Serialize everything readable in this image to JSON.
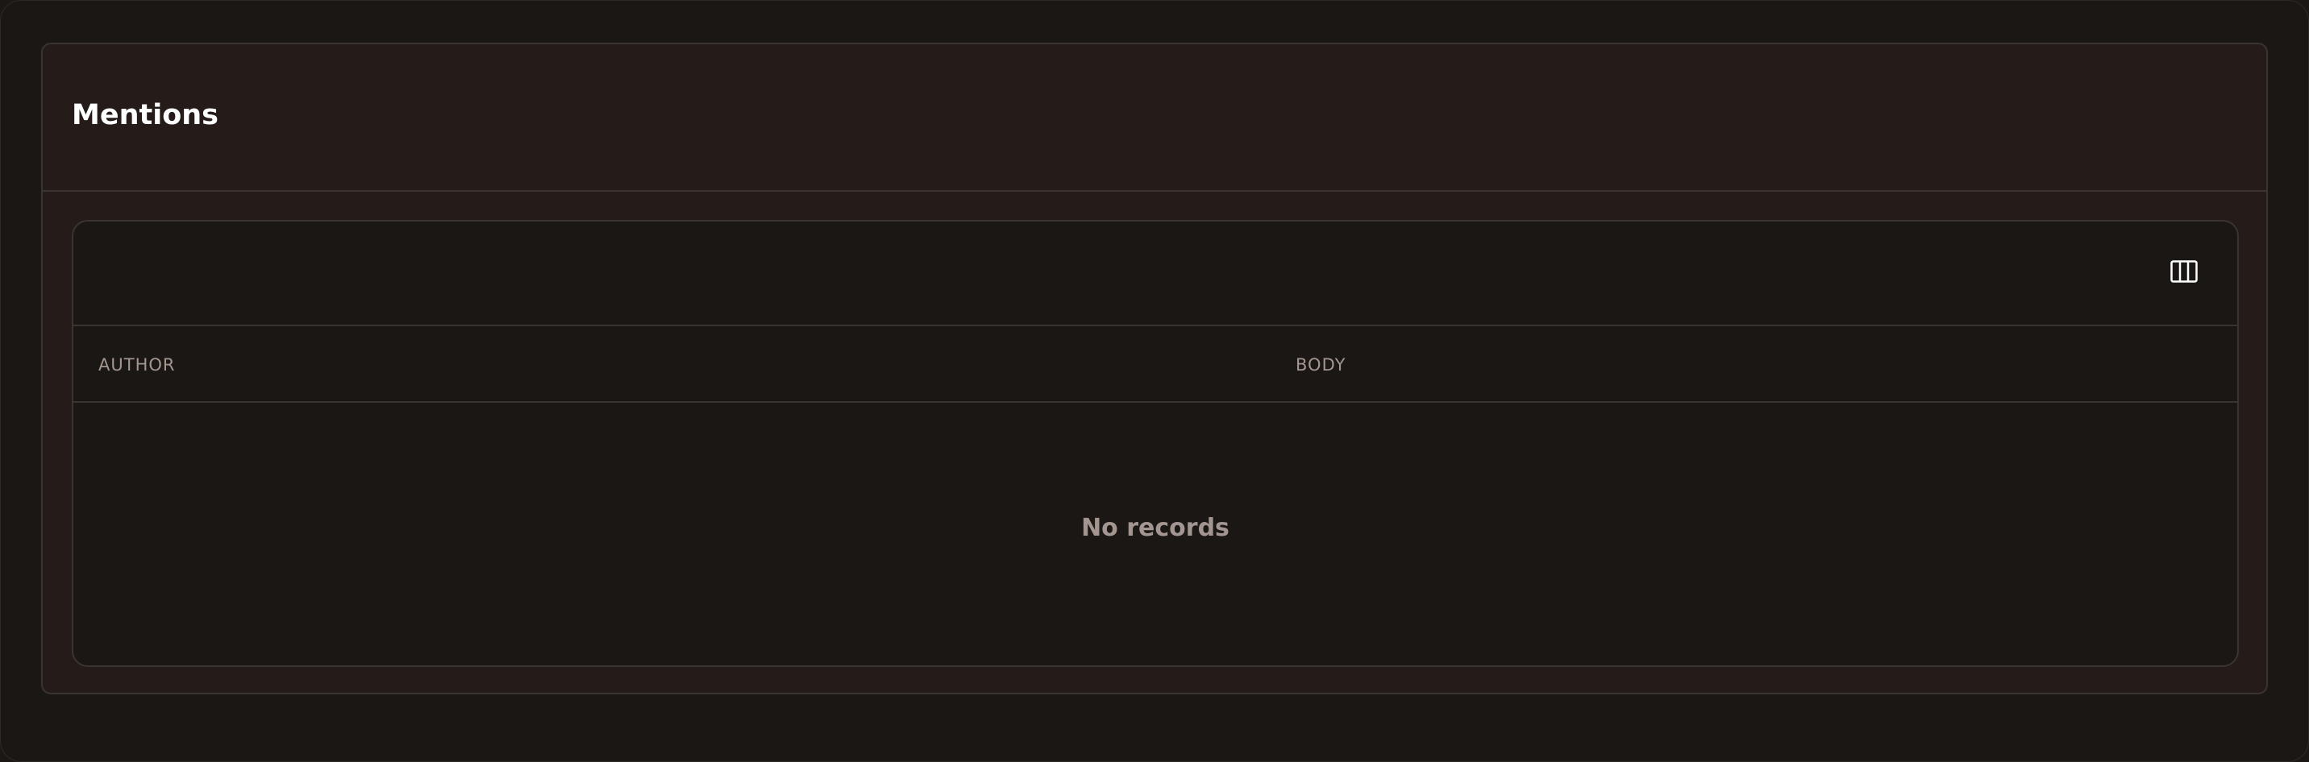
{
  "section": {
    "title": "Mentions"
  },
  "table": {
    "toolbar": {
      "columns_toggle_icon": "columns-icon"
    },
    "columns": [
      {
        "label": "AUTHOR"
      },
      {
        "label": "BODY"
      }
    ],
    "rows": [],
    "empty_message": "No records"
  },
  "colors": {
    "background": "#1b1714",
    "card": "#251c19",
    "border": "#3a3431",
    "title": "#ffffff",
    "muted_text": "#a39690"
  }
}
